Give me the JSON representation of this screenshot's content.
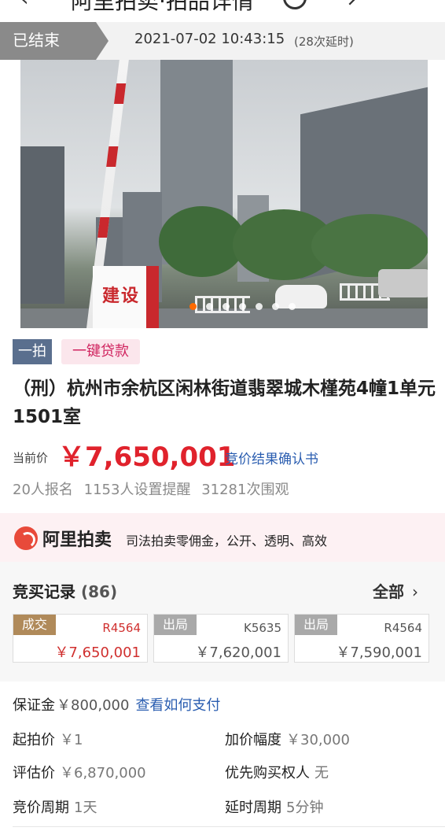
{
  "nav": {
    "back_icon": "‹",
    "title": "阿里拍卖·拍品详情",
    "more_icon": "↗"
  },
  "status": {
    "badge": "已结束",
    "end_time": "2021-07-02 10:43:15",
    "delay_note": "(28次延时)"
  },
  "photo": {
    "sign_text": "建设",
    "carousel_total": 7,
    "carousel_active": 1
  },
  "tags": {
    "first": "一拍",
    "loan": "一键贷款"
  },
  "lot": {
    "title": "（刑）杭州市余杭区闲林街道翡翠城木槿苑4幢1单元1501室"
  },
  "price": {
    "label": "当前价",
    "value": "￥7,650,001",
    "result_link": "竞价结果确认书"
  },
  "stats": {
    "signups": "20人报名",
    "reminders": "1153人设置提醒",
    "views": "31281次围观"
  },
  "brand": {
    "name": "阿里拍卖",
    "slogan": "司法拍卖零佣金，公开、透明、高效"
  },
  "bids": {
    "title": "竞买记录",
    "count": "(86)",
    "all_label": "全部",
    "all_icon": "›",
    "records": [
      {
        "status": "成交",
        "bidder": "R4564",
        "amount": "￥7,650,001"
      },
      {
        "status": "出局",
        "bidder": "K5635",
        "amount": "￥7,620,001"
      },
      {
        "status": "出局",
        "bidder": "R4564",
        "amount": "￥7,590,001"
      }
    ]
  },
  "details": {
    "deposit_label": "保证金",
    "deposit_value": "￥800,000",
    "deposit_link": "查看如何支付",
    "start_label": "起拍价",
    "start_value": "￥1",
    "increment_label": "加价幅度",
    "increment_value": "￥30,000",
    "appraisal_label": "评估价",
    "appraisal_value": "￥6,870,000",
    "priority_label": "优先购买权人",
    "priority_value": "无",
    "cycle_label": "竞价周期",
    "cycle_value": "1天",
    "delay_label": "延时周期",
    "delay_value": "5分钟"
  },
  "colors": {
    "accent_red": "#e0222c",
    "link_blue": "#2a5db0",
    "tag_blue": "#5a6f8e",
    "loan_pink": "#d0245f"
  }
}
